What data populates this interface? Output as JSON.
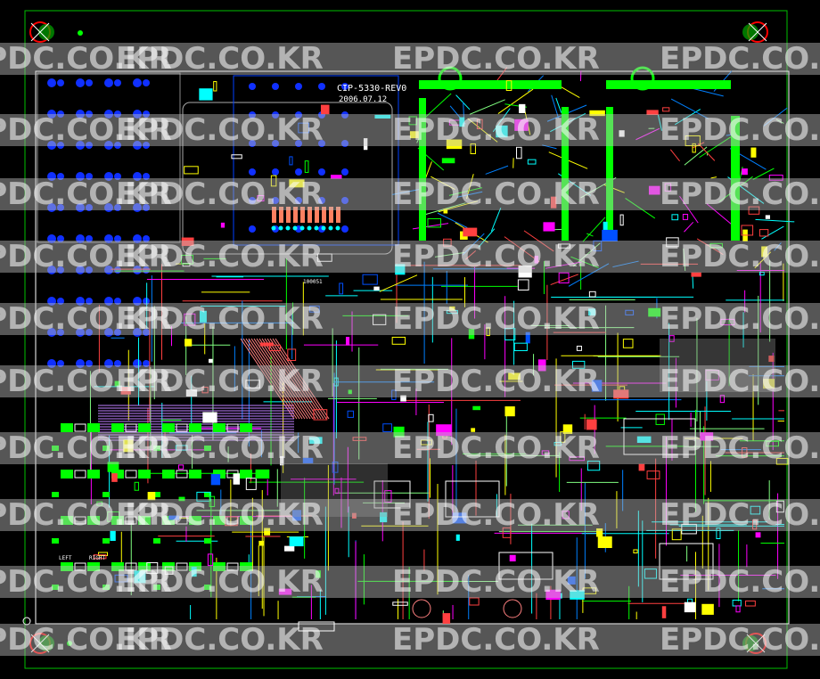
{
  "board": {
    "name": "CIP-5330-REV0",
    "date": "2006.07.12",
    "label_small_1": "100051",
    "label_small_2": "LEFT",
    "label_small_3": "RIGHT"
  },
  "watermark": {
    "text": "EPDC.CO.KR"
  },
  "colors": {
    "background": "#000000",
    "outline": "#00c000",
    "top_copper": "#00ff00",
    "trace_cyan": "#00ffff",
    "trace_magenta": "#ff00ff",
    "silkscreen": "#ffffff",
    "via": "#0000ff",
    "drill_mark": "#ff0000",
    "watermark_band": "#bfbfbf"
  },
  "icons": {
    "mounting_hole": "target-icon",
    "fiducial": "dot-icon"
  }
}
